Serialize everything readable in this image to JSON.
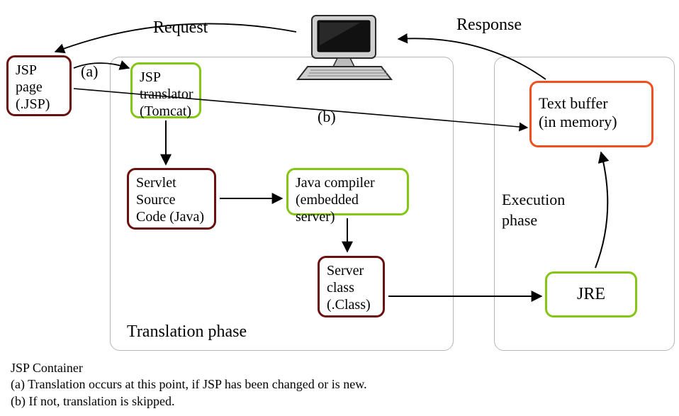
{
  "labels": {
    "request": "Request",
    "response": "Response",
    "a": "(a)",
    "b": "(b)",
    "translation_phase": "Translation phase",
    "execution_phase": "Execution phase"
  },
  "nodes": {
    "jsp_page": "JSP\npage\n(.JSP)",
    "jsp_translator": "JSP\ntranslator\n(Tomcat)",
    "servlet_source": "Servlet\nSource\nCode (Java)",
    "java_compiler": "Java compiler\n(embedded server)",
    "server_class": "Server\nclass\n(.Class)",
    "jre": "JRE",
    "text_buffer": "Text buffer\n(in memory)"
  },
  "caption": {
    "title": "JSP Container",
    "line_a": "(a) Translation occurs at this point, if JSP has been changed or is new.",
    "line_b": "(b) If not, translation is skipped."
  }
}
